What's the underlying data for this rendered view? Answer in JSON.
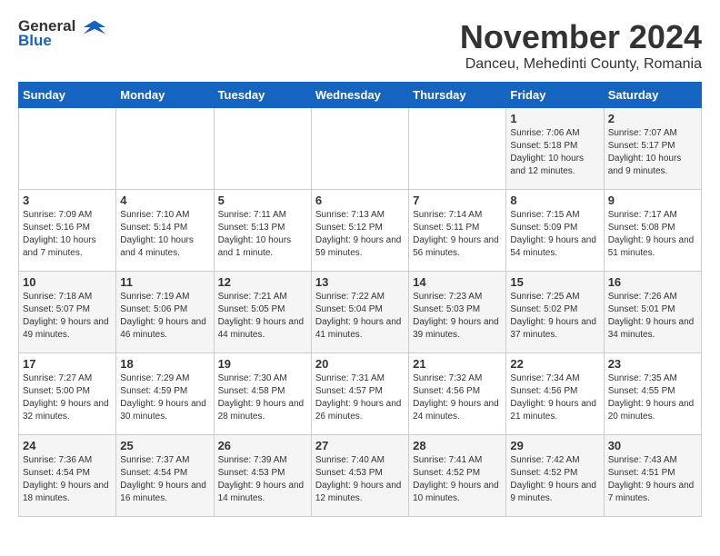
{
  "header": {
    "logo_general": "General",
    "logo_blue": "Blue",
    "title": "November 2024",
    "subtitle": "Danceu, Mehedinti County, Romania"
  },
  "weekdays": [
    "Sunday",
    "Monday",
    "Tuesday",
    "Wednesday",
    "Thursday",
    "Friday",
    "Saturday"
  ],
  "weeks": [
    [
      {
        "day": "",
        "info": ""
      },
      {
        "day": "",
        "info": ""
      },
      {
        "day": "",
        "info": ""
      },
      {
        "day": "",
        "info": ""
      },
      {
        "day": "",
        "info": ""
      },
      {
        "day": "1",
        "info": "Sunrise: 7:06 AM\nSunset: 5:18 PM\nDaylight: 10 hours and 12 minutes."
      },
      {
        "day": "2",
        "info": "Sunrise: 7:07 AM\nSunset: 5:17 PM\nDaylight: 10 hours and 9 minutes."
      }
    ],
    [
      {
        "day": "3",
        "info": "Sunrise: 7:09 AM\nSunset: 5:16 PM\nDaylight: 10 hours and 7 minutes."
      },
      {
        "day": "4",
        "info": "Sunrise: 7:10 AM\nSunset: 5:14 PM\nDaylight: 10 hours and 4 minutes."
      },
      {
        "day": "5",
        "info": "Sunrise: 7:11 AM\nSunset: 5:13 PM\nDaylight: 10 hours and 1 minute."
      },
      {
        "day": "6",
        "info": "Sunrise: 7:13 AM\nSunset: 5:12 PM\nDaylight: 9 hours and 59 minutes."
      },
      {
        "day": "7",
        "info": "Sunrise: 7:14 AM\nSunset: 5:11 PM\nDaylight: 9 hours and 56 minutes."
      },
      {
        "day": "8",
        "info": "Sunrise: 7:15 AM\nSunset: 5:09 PM\nDaylight: 9 hours and 54 minutes."
      },
      {
        "day": "9",
        "info": "Sunrise: 7:17 AM\nSunset: 5:08 PM\nDaylight: 9 hours and 51 minutes."
      }
    ],
    [
      {
        "day": "10",
        "info": "Sunrise: 7:18 AM\nSunset: 5:07 PM\nDaylight: 9 hours and 49 minutes."
      },
      {
        "day": "11",
        "info": "Sunrise: 7:19 AM\nSunset: 5:06 PM\nDaylight: 9 hours and 46 minutes."
      },
      {
        "day": "12",
        "info": "Sunrise: 7:21 AM\nSunset: 5:05 PM\nDaylight: 9 hours and 44 minutes."
      },
      {
        "day": "13",
        "info": "Sunrise: 7:22 AM\nSunset: 5:04 PM\nDaylight: 9 hours and 41 minutes."
      },
      {
        "day": "14",
        "info": "Sunrise: 7:23 AM\nSunset: 5:03 PM\nDaylight: 9 hours and 39 minutes."
      },
      {
        "day": "15",
        "info": "Sunrise: 7:25 AM\nSunset: 5:02 PM\nDaylight: 9 hours and 37 minutes."
      },
      {
        "day": "16",
        "info": "Sunrise: 7:26 AM\nSunset: 5:01 PM\nDaylight: 9 hours and 34 minutes."
      }
    ],
    [
      {
        "day": "17",
        "info": "Sunrise: 7:27 AM\nSunset: 5:00 PM\nDaylight: 9 hours and 32 minutes."
      },
      {
        "day": "18",
        "info": "Sunrise: 7:29 AM\nSunset: 4:59 PM\nDaylight: 9 hours and 30 minutes."
      },
      {
        "day": "19",
        "info": "Sunrise: 7:30 AM\nSunset: 4:58 PM\nDaylight: 9 hours and 28 minutes."
      },
      {
        "day": "20",
        "info": "Sunrise: 7:31 AM\nSunset: 4:57 PM\nDaylight: 9 hours and 26 minutes."
      },
      {
        "day": "21",
        "info": "Sunrise: 7:32 AM\nSunset: 4:56 PM\nDaylight: 9 hours and 24 minutes."
      },
      {
        "day": "22",
        "info": "Sunrise: 7:34 AM\nSunset: 4:56 PM\nDaylight: 9 hours and 21 minutes."
      },
      {
        "day": "23",
        "info": "Sunrise: 7:35 AM\nSunset: 4:55 PM\nDaylight: 9 hours and 20 minutes."
      }
    ],
    [
      {
        "day": "24",
        "info": "Sunrise: 7:36 AM\nSunset: 4:54 PM\nDaylight: 9 hours and 18 minutes."
      },
      {
        "day": "25",
        "info": "Sunrise: 7:37 AM\nSunset: 4:54 PM\nDaylight: 9 hours and 16 minutes."
      },
      {
        "day": "26",
        "info": "Sunrise: 7:39 AM\nSunset: 4:53 PM\nDaylight: 9 hours and 14 minutes."
      },
      {
        "day": "27",
        "info": "Sunrise: 7:40 AM\nSunset: 4:53 PM\nDaylight: 9 hours and 12 minutes."
      },
      {
        "day": "28",
        "info": "Sunrise: 7:41 AM\nSunset: 4:52 PM\nDaylight: 9 hours and 10 minutes."
      },
      {
        "day": "29",
        "info": "Sunrise: 7:42 AM\nSunset: 4:52 PM\nDaylight: 9 hours and 9 minutes."
      },
      {
        "day": "30",
        "info": "Sunrise: 7:43 AM\nSunset: 4:51 PM\nDaylight: 9 hours and 7 minutes."
      }
    ]
  ]
}
